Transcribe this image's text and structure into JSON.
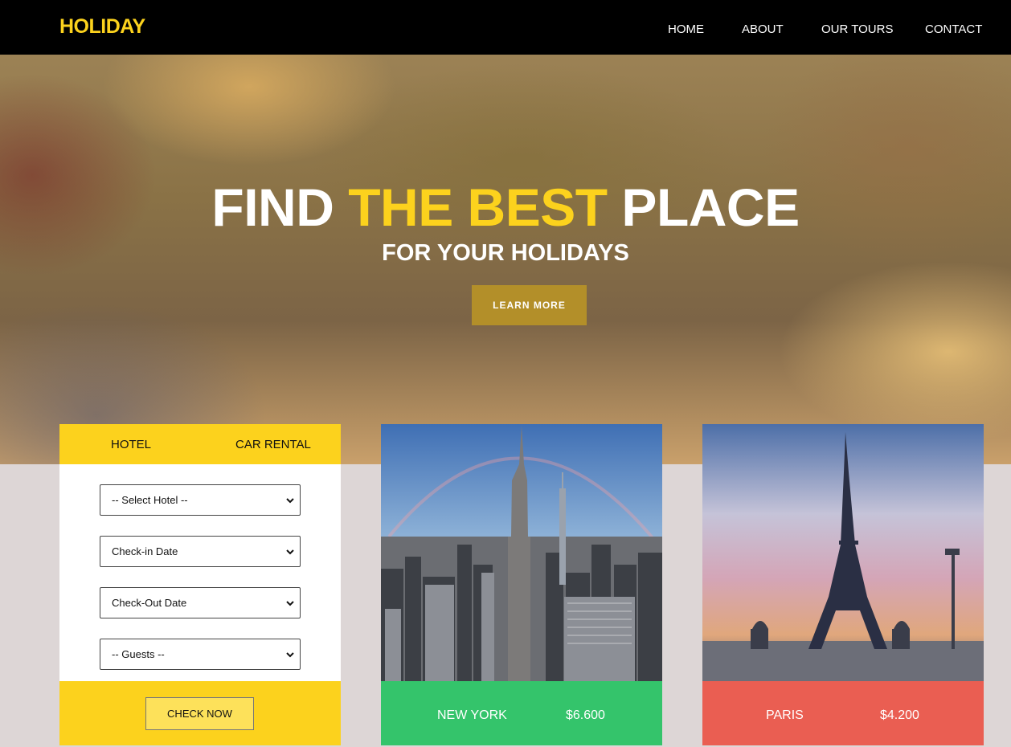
{
  "brand": {
    "logo": "HOLIDAY",
    "accent": "#fcd21d"
  },
  "nav": {
    "home": "HOME",
    "about": "ABOUT",
    "tours": "OUR TOURS",
    "contact": "CONTACT"
  },
  "hero": {
    "title_part1": "FIND",
    "title_highlight": "THE BEST",
    "title_part2": "PLACE",
    "subtitle": "FOR YOUR HOLIDAYS",
    "cta": "LEARN MORE",
    "cta_color": "#b38f29"
  },
  "booking": {
    "tabs": [
      "HOTEL",
      "CAR RENTAL"
    ],
    "fields": [
      "-- Select Hotel --",
      "Check-in Date",
      "Check-Out Date",
      "-- Guests --"
    ],
    "submit": "CHECK NOW"
  },
  "destinations": [
    {
      "name": "NEW YORK",
      "price": "$6.600",
      "color": "#34c46b",
      "icon": "city-skyline-photo"
    },
    {
      "name": "PARIS",
      "price": "$4.200",
      "color": "#ea5e52",
      "icon": "eiffel-tower-photo"
    }
  ]
}
